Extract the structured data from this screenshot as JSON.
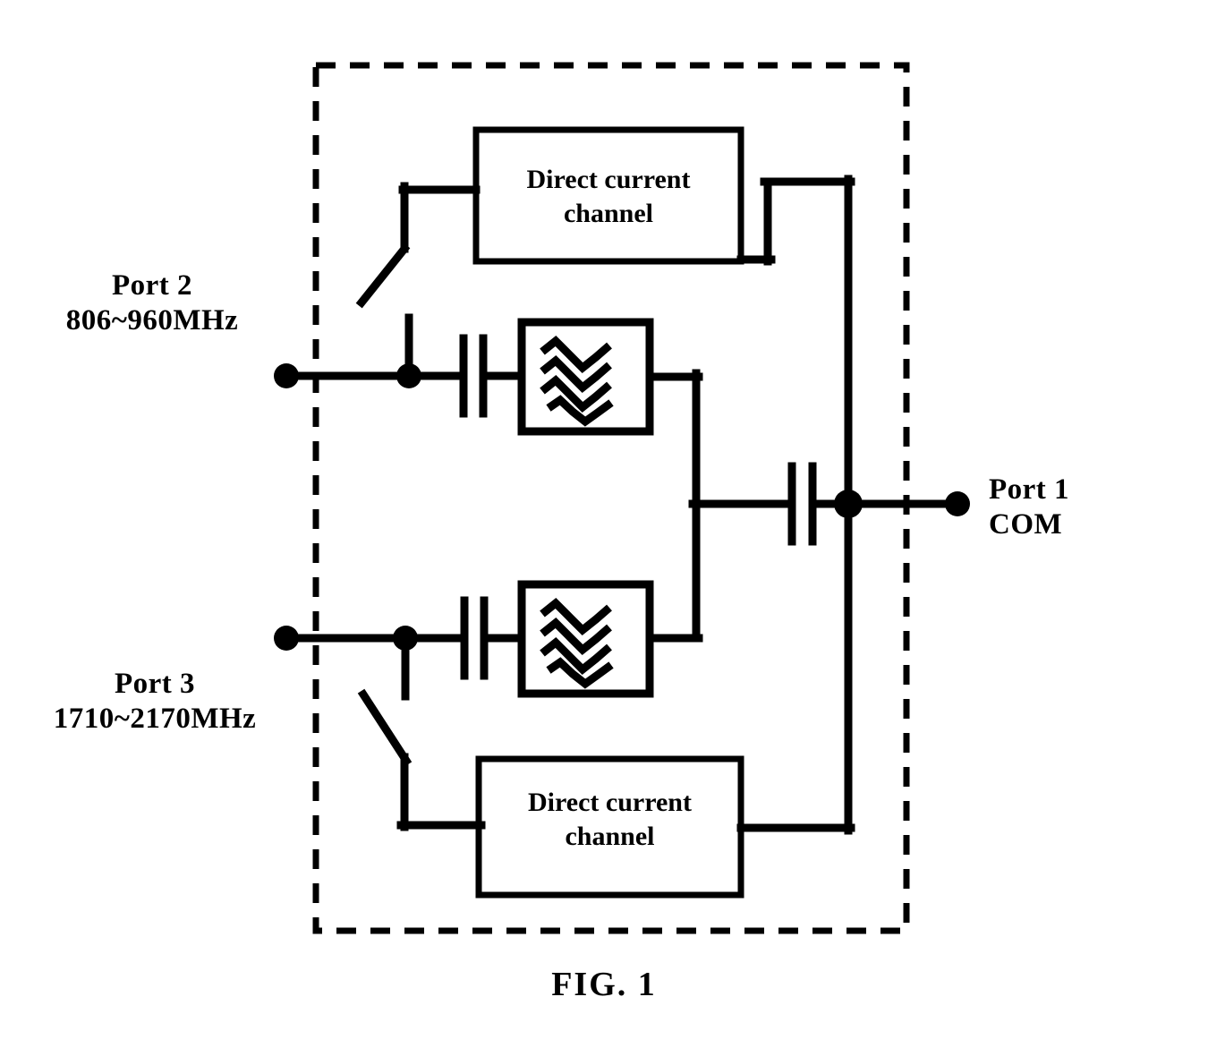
{
  "figure": {
    "caption": "FIG. 1",
    "enclosure_name": "duplexer-module-boundary",
    "line_color": "#000000",
    "background_color": "#ffffff"
  },
  "ports": {
    "port1": {
      "name": "Port 1",
      "detail": "COM",
      "position": "right"
    },
    "port2": {
      "name": "Port 2",
      "detail": "806~960MHz",
      "position": "upper-left"
    },
    "port3": {
      "name": "Port 3",
      "detail": "1710~2170MHz",
      "position": "lower-left"
    }
  },
  "blocks": {
    "dc_top": {
      "line1": "Direct current",
      "line2": "channel"
    },
    "dc_bottom": {
      "line1": "Direct current",
      "line2": "channel"
    },
    "filter_top": {
      "symbol": "filter-wave-symbol"
    },
    "filter_bottom": {
      "symbol": "filter-wave-symbol"
    }
  },
  "components": {
    "switch_top": "switch-symbol",
    "switch_bottom": "switch-symbol",
    "capacitor_port2": "capacitor-symbol",
    "capacitor_port3": "capacitor-symbol",
    "capacitor_com": "capacitor-symbol"
  }
}
